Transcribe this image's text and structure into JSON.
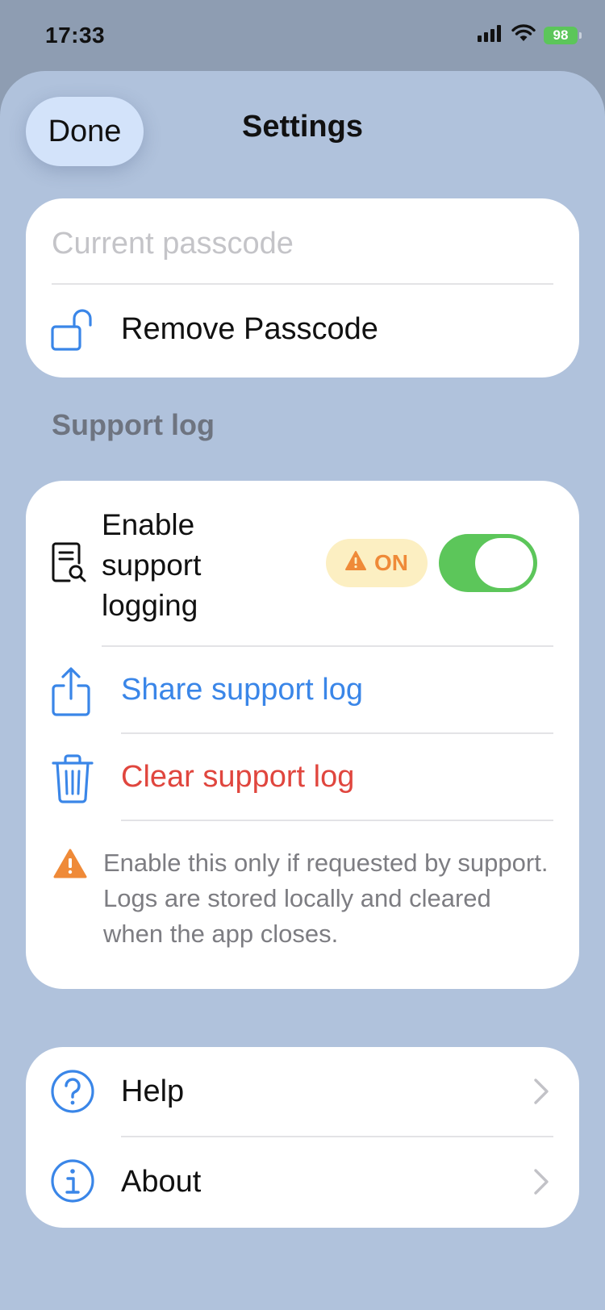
{
  "status_bar": {
    "time": "17:33",
    "battery": "98",
    "icons": [
      "signal-icon",
      "wifi-icon",
      "battery-icon"
    ]
  },
  "header": {
    "done_label": "Done",
    "title": "Settings"
  },
  "passcode": {
    "input_value": "",
    "input_placeholder": "Current passcode",
    "remove_label": "Remove Passcode",
    "icon": "unlock-icon"
  },
  "support_log": {
    "section_title": "Support log",
    "enable_label": "Enable support logging",
    "enable_icon": "document-search-icon",
    "status_badge": "ON",
    "toggle_on": true,
    "share_label": "Share support log",
    "share_icon": "share-icon",
    "clear_label": "Clear support log",
    "clear_icon": "trash-icon",
    "warning": "Enable this only if requested by support. Logs are stored locally and cleared when the app closes.",
    "warning_icon": "warning-icon"
  },
  "info": {
    "items": [
      {
        "label": "Help",
        "icon": "help-icon"
      },
      {
        "label": "About",
        "icon": "info-icon"
      }
    ]
  },
  "colors": {
    "accent_blue": "#3a86e8",
    "destructive_red": "#e0463e",
    "toggle_green": "#5cc65a",
    "warning_orange": "#ef8a38",
    "badge_bg": "#fcefc2",
    "sheet_bg": "#b0c2dc"
  }
}
